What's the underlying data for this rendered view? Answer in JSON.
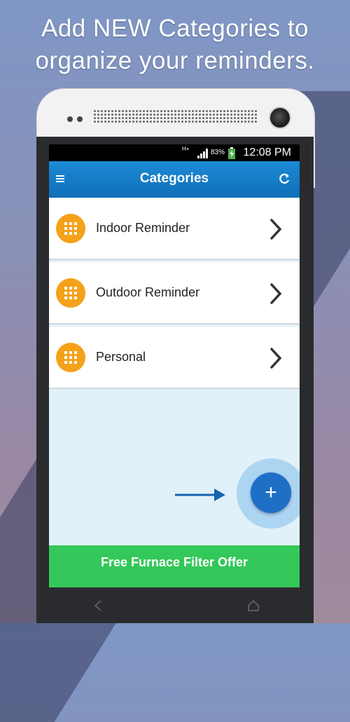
{
  "promo": {
    "line1": "Add NEW Categories to",
    "line2": "organize your reminders."
  },
  "status_bar": {
    "network": "H+",
    "battery": "83%",
    "time": "12:08 PM",
    "icons": [
      "signal-icon",
      "battery-charging-icon"
    ]
  },
  "app_bar": {
    "title": "Categories",
    "menu_icon": "hamburger-menu-icon",
    "refresh_icon": "refresh-icon"
  },
  "categories": [
    {
      "label": "Indoor Reminder",
      "icon": "grid-icon"
    },
    {
      "label": "Outdoor Reminder",
      "icon": "grid-icon"
    },
    {
      "label": "Personal",
      "icon": "grid-icon"
    }
  ],
  "fab": {
    "label": "+"
  },
  "offer": {
    "label": "Free Furnace Filter Offer"
  },
  "colors": {
    "appbar": "#1478c8",
    "category_icon": "#f5a11a",
    "fab": "#1f6fc6",
    "offer": "#34c759"
  }
}
